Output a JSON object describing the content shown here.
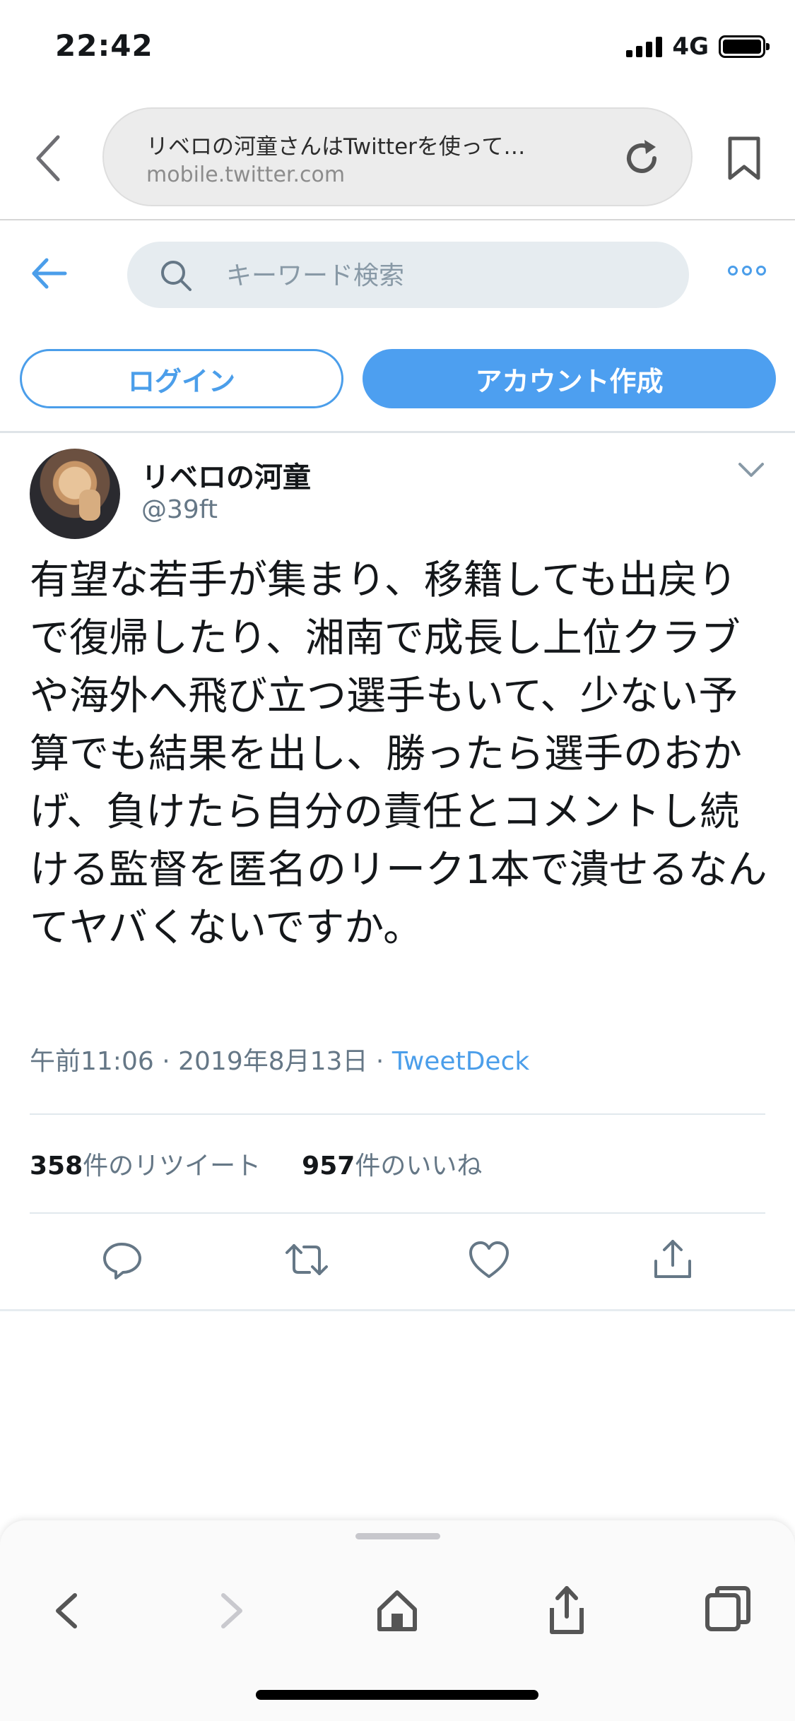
{
  "status_bar": {
    "time": "22:42",
    "network": "4G"
  },
  "browser": {
    "page_title": "リベロの河童さんはTwitterを使って…",
    "host": "mobile.twitter.com"
  },
  "twitter_header": {
    "search_placeholder": "キーワード検索"
  },
  "auth": {
    "login_label": "ログイン",
    "signup_label": "アカウント作成"
  },
  "tweet": {
    "author_name": "リベロの河童",
    "author_handle": "@39ft",
    "text": "有望な若手が集まり、移籍しても出戻りで復帰したり、湘南で成長し上位クラブや海外へ飛び立つ選手もいて、少ない予算でも結果を出し、勝ったら選手のおかげ、負けたら自分の責任とコメントし続ける監督を匿名のリーク1本で潰せるなんてヤバくないですか。",
    "time": "午前11:06",
    "dot1": "·",
    "date": "2019年8月13日",
    "dot2": "·",
    "via": "TweetDeck",
    "retweet_count": "358",
    "retweet_label": "件のリツイート",
    "like_count": "957",
    "like_label": "件のいいね"
  },
  "colors": {
    "twitter_blue": "#4b9eea",
    "secondary_text": "#657786",
    "primary_text": "#14171a"
  },
  "icons": [
    "back-chevron-icon",
    "reload-icon",
    "bookmark-icon",
    "arrow-left-icon",
    "search-icon",
    "more-icon",
    "chevron-down-icon",
    "reply-icon",
    "retweet-icon",
    "like-icon",
    "share-icon",
    "safari-back-icon",
    "safari-forward-icon",
    "home-icon",
    "safari-share-icon",
    "tabs-icon"
  ]
}
